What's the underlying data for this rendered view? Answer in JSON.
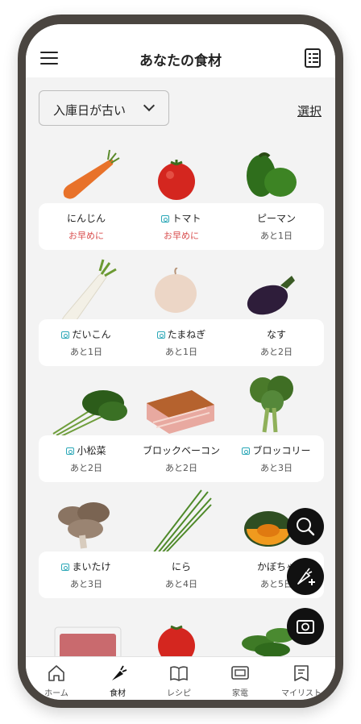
{
  "header": {
    "title": "あなたの食材"
  },
  "sort": {
    "label": "入庫日が古い"
  },
  "actions": {
    "select": "選択"
  },
  "items": [
    {
      "name": "にんじん",
      "status": "お早めに",
      "urgent": true,
      "camera": false
    },
    {
      "name": "トマト",
      "status": "お早めに",
      "urgent": true,
      "camera": true
    },
    {
      "name": "ピーマン",
      "status": "あと1日",
      "urgent": false,
      "camera": false
    },
    {
      "name": "だいこん",
      "status": "あと1日",
      "urgent": false,
      "camera": true
    },
    {
      "name": "たまねぎ",
      "status": "あと1日",
      "urgent": false,
      "camera": true
    },
    {
      "name": "なす",
      "status": "あと2日",
      "urgent": false,
      "camera": false
    },
    {
      "name": "小松菜",
      "status": "あと2日",
      "urgent": false,
      "camera": true
    },
    {
      "name": "ブロックベーコン",
      "status": "あと2日",
      "urgent": false,
      "camera": false
    },
    {
      "name": "ブロッコリー",
      "status": "あと3日",
      "urgent": false,
      "camera": true
    },
    {
      "name": "まいたけ",
      "status": "あと3日",
      "urgent": false,
      "camera": true
    },
    {
      "name": "にら",
      "status": "あと4日",
      "urgent": false,
      "camera": false
    },
    {
      "name": "かぼちゃ",
      "status": "あと5日",
      "urgent": false,
      "camera": false
    }
  ],
  "nav": [
    {
      "label": "ホーム",
      "icon": "home-icon"
    },
    {
      "label": "食材",
      "icon": "carrot-icon"
    },
    {
      "label": "レシピ",
      "icon": "book-icon"
    },
    {
      "label": "家電",
      "icon": "appliance-icon"
    },
    {
      "label": "マイリスト",
      "icon": "mylist-icon"
    }
  ],
  "colors": {
    "urgent": "#d94e4e",
    "camera_icon": "#2aa7b7",
    "fab": "#111111"
  }
}
